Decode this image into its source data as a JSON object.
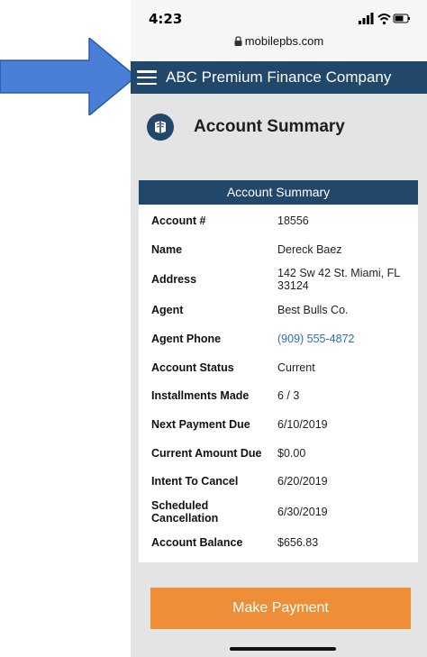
{
  "status_bar": {
    "time": "4:23",
    "url": "mobilepbs.com"
  },
  "header": {
    "title": "ABC Premium Finance Company"
  },
  "page": {
    "title": "Account Summary"
  },
  "summary": {
    "header": "Account Summary",
    "rows": [
      {
        "label": "Account #",
        "value": "18556"
      },
      {
        "label": "Name",
        "value": "Dereck Baez"
      },
      {
        "label": "Address",
        "value": "142 Sw 42 St. Miami, FL 33124"
      },
      {
        "label": "Agent",
        "value": "Best Bulls Co."
      },
      {
        "label": "Agent Phone",
        "value": "(909) 555-4872"
      },
      {
        "label": "Account Status",
        "value": "Current"
      },
      {
        "label": "Installments Made",
        "value": "6 / 3"
      },
      {
        "label": "Next Payment Due",
        "value": "6/10/2019"
      },
      {
        "label": "Current Amount Due",
        "value": "$0.00"
      },
      {
        "label": "Intent To Cancel",
        "value": "6/20/2019"
      },
      {
        "label": "Scheduled Cancellation",
        "value": "6/30/2019"
      },
      {
        "label": "Account Balance",
        "value": "$656.83"
      }
    ]
  },
  "actions": {
    "make_payment": "Make Payment"
  },
  "colors": {
    "brand": "#21476a",
    "button": "#ee8e36",
    "link": "#2f6cb5",
    "arrow": "#4a7fd8"
  }
}
